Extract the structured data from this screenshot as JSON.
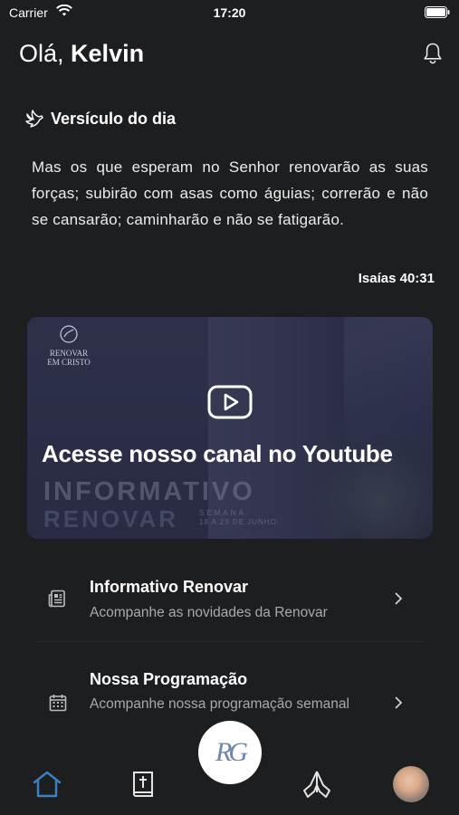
{
  "status_bar": {
    "carrier": "Carrier",
    "time": "17:20"
  },
  "header": {
    "greeting_prefix": "Olá,",
    "user_name": "Kelvin"
  },
  "verse": {
    "title": "Versículo do dia",
    "text": "Mas os que esperam no Senhor renovarão as suas forças; subirão com asas como águias; correrão e não se cansarão; caminharão e não se fatigarão.",
    "reference": "Isaías 40:31"
  },
  "youtube_banner": {
    "title": "Acesse nosso canal no Youtube",
    "logo_line1": "RENOVAR",
    "logo_line2": "EM CRISTO",
    "bg_line1": "INFORMATIVO",
    "bg_line2": "RENOVAR",
    "bg_week": "SEMANA",
    "bg_date": "18 A 23 DE JUNHO"
  },
  "list": [
    {
      "title": "Informativo Renovar",
      "subtitle": "Acompanhe as novidades da Renovar",
      "icon": "newspaper-icon"
    },
    {
      "title": "Nossa Programação",
      "subtitle": "Acompanhe nossa programação semanal",
      "icon": "calendar-icon"
    }
  ],
  "tab_bar": {
    "center_logo": "RG",
    "tabs": [
      "home-icon",
      "bible-icon",
      "prayer-hands-icon",
      "profile-avatar"
    ]
  },
  "colors": {
    "background": "#1d1e20",
    "accent": "#3b82c4",
    "subtitle": "#a9aaad"
  }
}
